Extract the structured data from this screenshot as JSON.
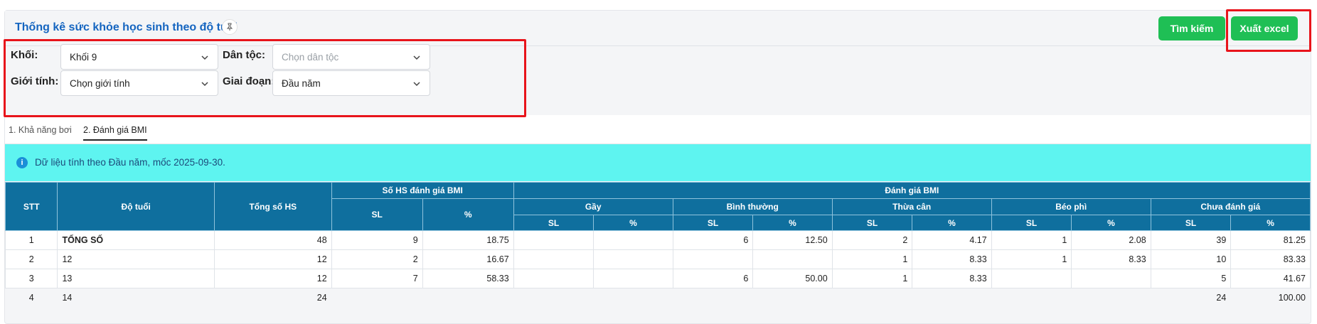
{
  "header": {
    "title": "Thống kê sức khỏe học sinh theo độ tuổi",
    "search_button": "Tìm kiếm",
    "export_button": "Xuất excel"
  },
  "filters": {
    "grade_label": "Khối:",
    "grade_value": "Khối 9",
    "ethnicity_label": "Dân tộc:",
    "ethnicity_placeholder": "Chọn dân tộc",
    "gender_label": "Giới tính:",
    "gender_placeholder": "Chọn giới tính",
    "period_label": "Giai đoạn:",
    "period_value": "Đầu năm"
  },
  "tabs": [
    {
      "label": "1. Khả năng bơi",
      "active": false
    },
    {
      "label": "2. Đánh giá BMI",
      "active": true
    }
  ],
  "info": {
    "text": "Dữ liệu tính theo Đầu năm, mốc 2025-09-30.",
    "icon": "i"
  },
  "table": {
    "headers": {
      "stt": "STT",
      "age": "Độ tuổi",
      "total": "Tổng số HS",
      "assessed": "Số HS đánh giá BMI",
      "bmi": "Đánh giá BMI",
      "sl": "SL",
      "pct": "%",
      "groups": [
        "Gầy",
        "Bình thường",
        "Thừa cân",
        "Béo phì",
        "Chưa đánh giá"
      ]
    },
    "rows": [
      [
        "1",
        "TỔNG SỐ",
        "48",
        "9",
        "18.75",
        "",
        "",
        "6",
        "12.50",
        "2",
        "4.17",
        "1",
        "2.08",
        "39",
        "81.25"
      ],
      [
        "2",
        "12",
        "12",
        "2",
        "16.67",
        "",
        "",
        "",
        "",
        "1",
        "8.33",
        "1",
        "8.33",
        "10",
        "83.33"
      ],
      [
        "3",
        "13",
        "12",
        "7",
        "58.33",
        "",
        "",
        "6",
        "50.00",
        "1",
        "8.33",
        "",
        "",
        "5",
        "41.67"
      ],
      [
        "4",
        "14",
        "24",
        "",
        "",
        "",
        "",
        "",
        "",
        "",
        "",
        "",
        "",
        "24",
        "100.00"
      ]
    ]
  },
  "colors": {
    "title": "#1565c0",
    "button": "#1fbf55",
    "table_header": "#0f6f9e",
    "info_bg": "#5ef4f0",
    "highlight": "#e8141b"
  }
}
